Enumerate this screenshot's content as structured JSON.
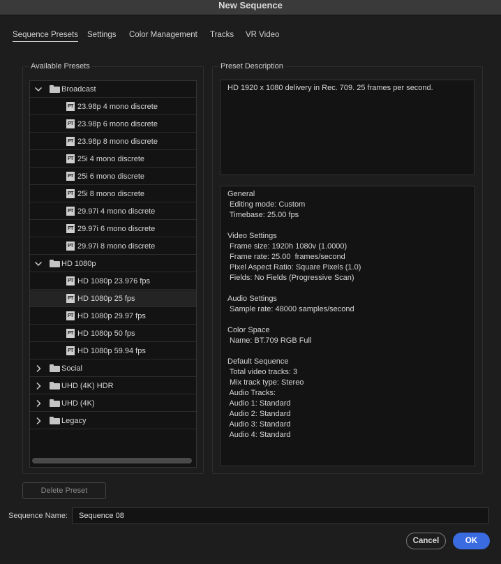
{
  "window": {
    "title": "New Sequence"
  },
  "tabs": [
    {
      "label": "Sequence Presets",
      "active": true
    },
    {
      "label": "Settings"
    },
    {
      "label": "Color Management"
    },
    {
      "label": "Tracks"
    },
    {
      "label": "VR Video"
    }
  ],
  "presets": {
    "heading": "Available Presets",
    "tree": [
      {
        "type": "folder",
        "label": "Broadcast",
        "expanded": true
      },
      {
        "type": "item",
        "label": "23.98p 4 mono discrete"
      },
      {
        "type": "item",
        "label": "23.98p 6 mono discrete"
      },
      {
        "type": "item",
        "label": "23.98p 8 mono discrete"
      },
      {
        "type": "item",
        "label": "25i 4 mono discrete"
      },
      {
        "type": "item",
        "label": "25i 6 mono discrete"
      },
      {
        "type": "item",
        "label": "25i 8 mono discrete"
      },
      {
        "type": "item",
        "label": "29.97i 4 mono discrete"
      },
      {
        "type": "item",
        "label": "29.97i 6 mono discrete"
      },
      {
        "type": "item",
        "label": "29.97i 8 mono discrete"
      },
      {
        "type": "folder",
        "label": "HD 1080p",
        "expanded": true
      },
      {
        "type": "item",
        "label": "HD 1080p 23.976 fps"
      },
      {
        "type": "item",
        "label": "HD 1080p 25 fps",
        "selected": true
      },
      {
        "type": "item",
        "label": "HD 1080p 29.97 fps"
      },
      {
        "type": "item",
        "label": "HD 1080p 50 fps"
      },
      {
        "type": "item",
        "label": "HD 1080p 59.94 fps"
      },
      {
        "type": "folder",
        "label": "Social",
        "expanded": false
      },
      {
        "type": "folder",
        "label": "UHD (4K) HDR",
        "expanded": false
      },
      {
        "type": "folder",
        "label": "UHD (4K)",
        "expanded": false
      },
      {
        "type": "folder",
        "label": "Legacy",
        "expanded": false
      }
    ],
    "preset_icon_text": "PT",
    "delete_label": "Delete Preset"
  },
  "description": {
    "heading": "Preset Description",
    "text": "HD 1920 x 1080 delivery in Rec. 709. 25 frames per second.",
    "details": [
      "General",
      " Editing mode: Custom",
      " Timebase: 25.00 fps",
      "",
      "Video Settings",
      " Frame size: 1920h 1080v (1.0000)",
      " Frame rate: 25.00  frames/second",
      " Pixel Aspect Ratio: Square Pixels (1.0)",
      " Fields: No Fields (Progressive Scan)",
      "",
      "Audio Settings",
      " Sample rate: 48000 samples/second",
      "",
      "Color Space",
      " Name: BT.709 RGB Full",
      "",
      "Default Sequence",
      " Total video tracks: 3",
      " Mix track type: Stereo",
      " Audio Tracks:",
      " Audio 1: Standard",
      " Audio 2: Standard",
      " Audio 3: Standard",
      " Audio 4: Standard"
    ]
  },
  "footer": {
    "sequence_name_label": "Sequence Name:",
    "sequence_name_value": "Sequence 08",
    "cancel_label": "Cancel",
    "ok_label": "OK"
  },
  "colors": {
    "accent": "#3a6be0",
    "background": "#1d1d1d",
    "panel": "#131313"
  }
}
